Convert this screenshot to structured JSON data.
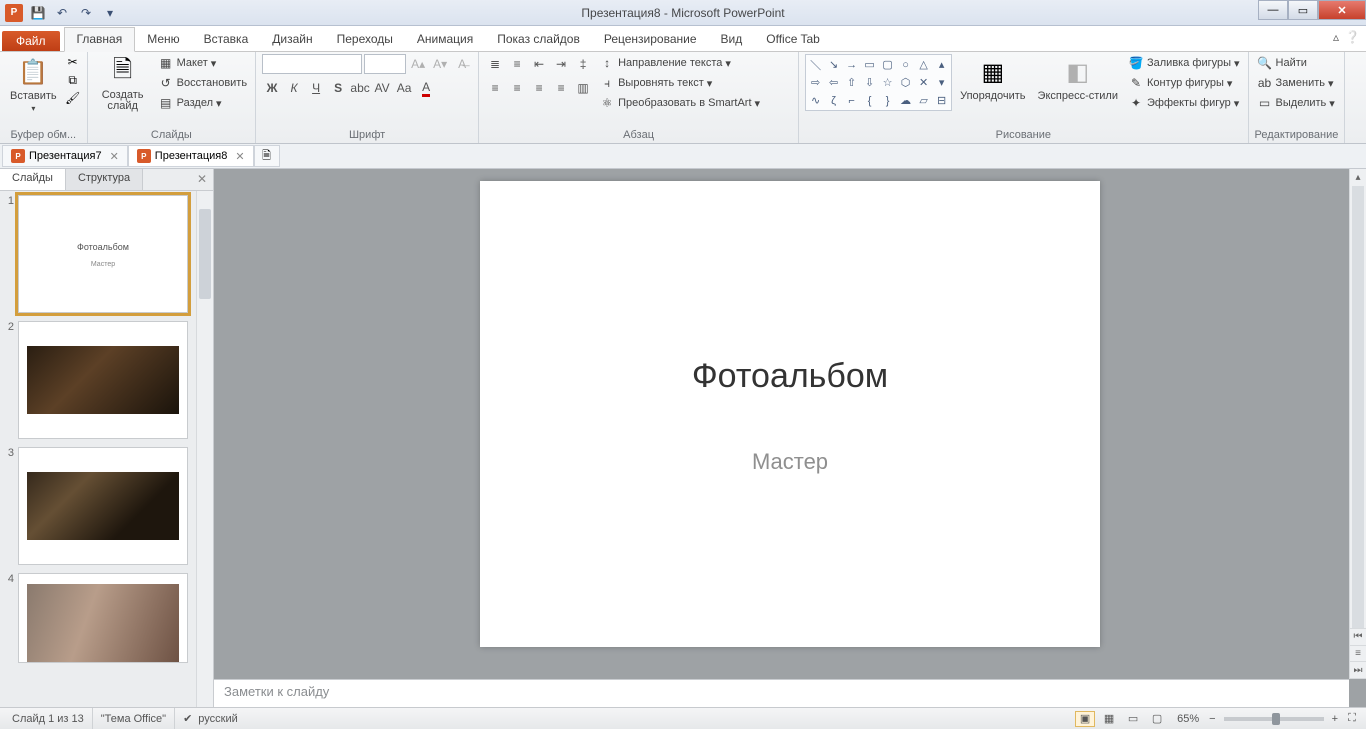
{
  "app": {
    "title": "Презентация8 - Microsoft PowerPoint",
    "logo": "P"
  },
  "qat": {
    "save": "save",
    "undo": "undo",
    "redo": "redo",
    "customize": "▾"
  },
  "win": {
    "min": "—",
    "max": "▭",
    "close": "✕"
  },
  "tabs": {
    "file": "Файл",
    "items": [
      "Главная",
      "Меню",
      "Вставка",
      "Дизайн",
      "Переходы",
      "Анимация",
      "Показ слайдов",
      "Рецензирование",
      "Вид",
      "Office Tab"
    ],
    "active": 0
  },
  "ribbon": {
    "clipboard": {
      "paste": "Вставить",
      "label": "Буфер обм..."
    },
    "slides": {
      "new": "Создать слайд",
      "layout": "Макет",
      "reset": "Восстановить",
      "section": "Раздел",
      "label": "Слайды"
    },
    "font": {
      "label": "Шрифт"
    },
    "para": {
      "direction": "Направление текста",
      "align": "Выровнять текст",
      "smartart": "Преобразовать в SmartArt",
      "label": "Абзац"
    },
    "draw": {
      "arrange": "Упорядочить",
      "quick": "Экспресс-стили",
      "fill": "Заливка фигуры",
      "outline": "Контур фигуры",
      "effects": "Эффекты фигур",
      "label": "Рисование"
    },
    "edit": {
      "find": "Найти",
      "replace": "Заменить",
      "select": "Выделить",
      "label": "Редактирование"
    }
  },
  "doctabs": {
    "items": [
      {
        "name": "Презентация7"
      },
      {
        "name": "Презентация8"
      }
    ],
    "active": 1
  },
  "leftpanel": {
    "tab_slides": "Слайды",
    "tab_outline": "Структура"
  },
  "thumbs": {
    "count": 4,
    "title": "Фотоальбом",
    "sub": "Мастер"
  },
  "slide": {
    "title": "Фотоальбом",
    "subtitle": "Мастер"
  },
  "notes": {
    "placeholder": "Заметки к слайду"
  },
  "status": {
    "slide": "Слайд 1 из 13",
    "theme": "\"Тема Office\"",
    "lang": "русский",
    "zoom": "65%"
  }
}
